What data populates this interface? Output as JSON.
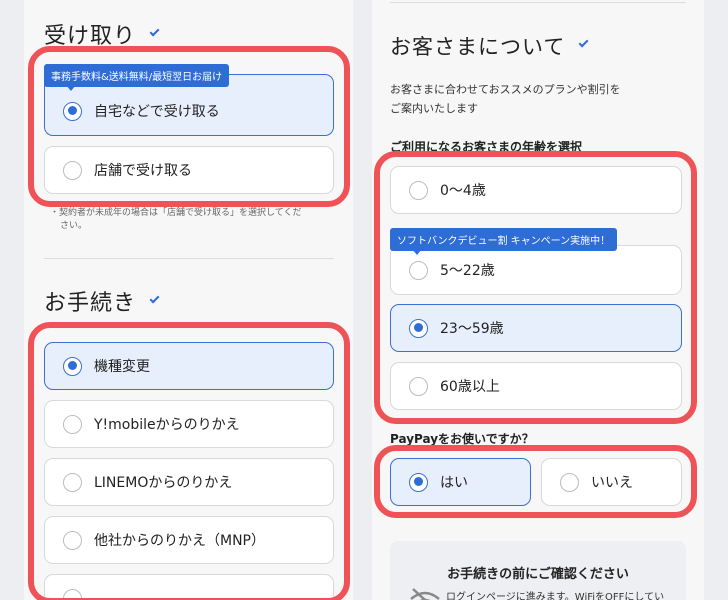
{
  "receive": {
    "title": "受け取り",
    "badge": "事務手数料&送料無料/最短翌日お届け",
    "options": [
      {
        "label": "自宅などで受け取る",
        "selected": true
      },
      {
        "label": "店舗で受け取る",
        "selected": false
      }
    ],
    "note_line1": "・契約者が未成年の場合は「店舗で受け取る」を選択してくだ",
    "note_line2": "さい。"
  },
  "procedure": {
    "title": "お手続き",
    "options": [
      {
        "label": "機種変更",
        "selected": true
      },
      {
        "label": "Y!mobileからのりかえ",
        "selected": false
      },
      {
        "label": "LINEMOからのりかえ",
        "selected": false
      },
      {
        "label": "他社からのりかえ（MNP）",
        "selected": false
      }
    ]
  },
  "customer": {
    "title": "お客さまについて",
    "desc_line1": "お客さまに合わせておススメのプランや割引を",
    "desc_line2": "ご案内いたします",
    "age_label": "ご利用になるお客さまの年齢を選択",
    "age_badge": "ソフトバンクデビュー割 キャンペーン実施中！",
    "age_options": [
      {
        "label": "0〜4歳",
        "selected": false
      },
      {
        "label": "5〜22歳",
        "selected": false
      },
      {
        "label": "23〜59歳",
        "selected": true
      },
      {
        "label": "60歳以上",
        "selected": false
      }
    ],
    "paypay_label": "PayPayをお使いですか？",
    "paypay_options": [
      {
        "label": "はい",
        "selected": true
      },
      {
        "label": "いいえ",
        "selected": false
      }
    ]
  },
  "confirm": {
    "title": "お手続きの前にご確認ください",
    "text": "ログインページに進みます。WiFiをOFFにしてい"
  },
  "colors": {
    "accent": "#2e6cd6",
    "highlight": "#ef5257",
    "selected_bg": "#e8effc"
  }
}
